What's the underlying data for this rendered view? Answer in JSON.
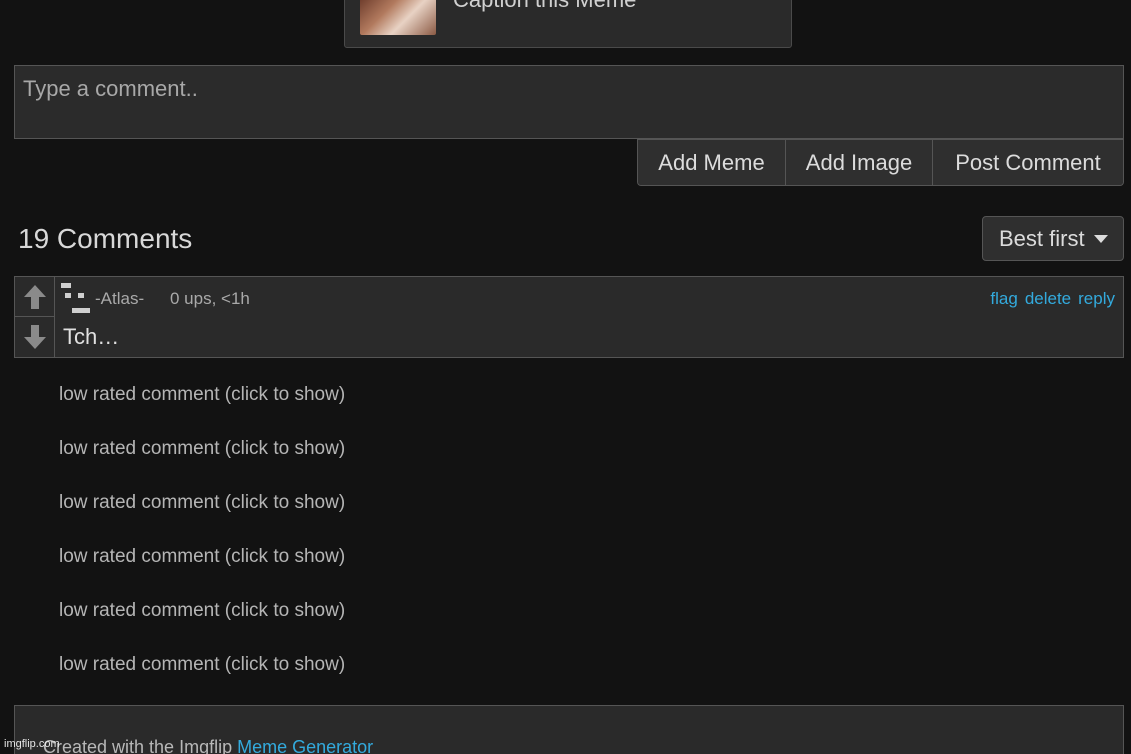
{
  "caption": {
    "text": "Caption this Meme"
  },
  "comment_form": {
    "placeholder": "Type a comment..",
    "add_meme_label": "Add Meme",
    "add_image_label": "Add Image",
    "post_label": "Post Comment"
  },
  "comments_header": {
    "count_label": "19 Comments",
    "sort_label": "Best first"
  },
  "comment": {
    "username": "-Atlas-",
    "meta": "0 ups, <1h",
    "actions": [
      "flag",
      "delete",
      "reply"
    ],
    "text": "Tch…"
  },
  "low_rated": [
    "low rated comment (click to show)",
    "low rated comment (click to show)",
    "low rated comment (click to show)",
    "low rated comment (click to show)",
    "low rated comment (click to show)",
    "low rated comment (click to show)"
  ],
  "footer": {
    "text": "Created with the Imgflip ",
    "link": "Meme Generator"
  },
  "watermark": "imgflip.com",
  "colors": {
    "background": "#121212",
    "panel": "#2a2a2a",
    "link": "#33aadd"
  }
}
